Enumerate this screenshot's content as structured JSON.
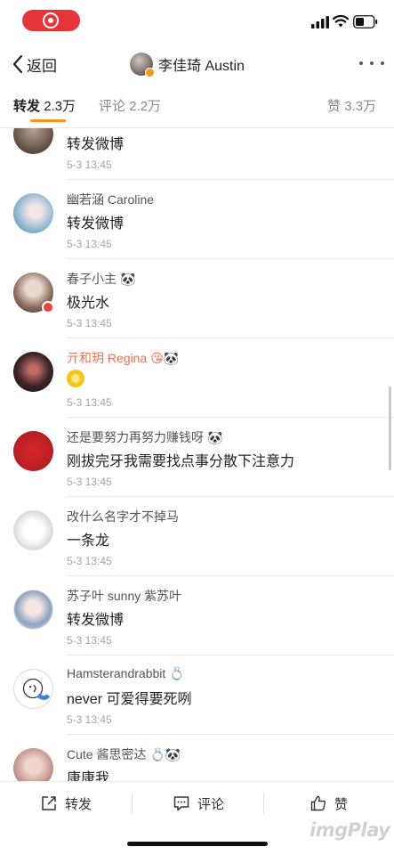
{
  "nav": {
    "back_label": "返回",
    "title": "李佳琦 Austin"
  },
  "tabs": {
    "repost_label": "转发",
    "repost_count": "2.3万",
    "comment_label": "评论",
    "comment_count": "2.2万",
    "like_label": "赞",
    "like_count": "3.3万"
  },
  "reposts": [
    {
      "name": "",
      "text": "转发微博",
      "time": "5-3 13:45"
    },
    {
      "name": "幽若涵 Caroline",
      "text": "转发微博",
      "time": "5-3 13:45"
    },
    {
      "name": "春子小主",
      "badge": "🐼",
      "text": "极光水",
      "time": "5-3 13:45"
    },
    {
      "name": "亓和玥 Regina",
      "badge": "😘🐼",
      "vip": true,
      "text": "",
      "time": "5-3 13:45"
    },
    {
      "name": "还是要努力再努力赚钱呀",
      "badge": "🐼",
      "text": "刚拔完牙我需要找点事分散下注意力",
      "time": "5-3 13:45"
    },
    {
      "name": "改什么名字才不掉马",
      "text": "一条龙",
      "time": "5-3 13:45"
    },
    {
      "name": "苏子叶 sunny 紫苏叶",
      "text": "转发微博",
      "time": "5-3 13:45"
    },
    {
      "name": "Hamsterandrabbit",
      "badge": "💍",
      "text": "never 可爱得要死咧",
      "time": "5-3 13:45"
    },
    {
      "name": "Cute 酱思密达",
      "badge": "💍🐼",
      "text": "康康我",
      "time": ""
    }
  ],
  "toolbar": {
    "repost_label": "转发",
    "comment_label": "评论",
    "like_label": "赞"
  },
  "watermark": "imgPlay",
  "colors": {
    "accent": "#f7931e",
    "vip_name": "#eb7350",
    "record": "#e5343a"
  }
}
